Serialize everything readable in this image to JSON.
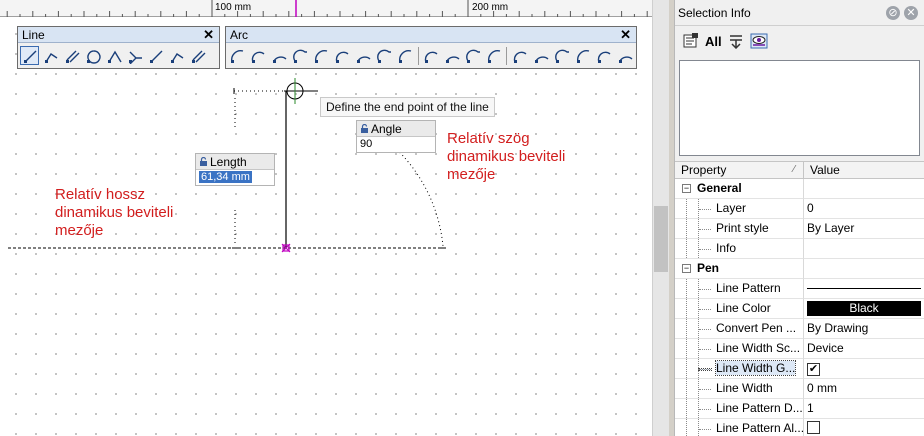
{
  "ruler": {
    "label_100": "100 mm",
    "label_200": "200 mm"
  },
  "line_toolbar": {
    "title": "Line",
    "close": "✕",
    "icons": [
      "line-icon",
      "polyline-icon",
      "parallel-line-icon",
      "tangent-line-icon",
      "perpendicular-line-icon",
      "angle-line-icon",
      "bisector-line-icon",
      "extend-line-icon",
      "split-line-icon"
    ]
  },
  "arc_toolbar": {
    "title": "Arc",
    "close": "✕",
    "icons": [
      "arc-3point-icon",
      "arc-center-icon",
      "arc-start-end-icon",
      "arc-tangent-icon",
      "arc-radius-icon",
      "arc-chord-icon",
      "arc-continue-icon",
      "arc-angle-icon",
      "arc-mirror-icon",
      "arc-concentric-icon",
      "arc-offset-icon",
      "arc-fillet-icon",
      "arc-reverse-icon",
      "arc-join-icon",
      "arc-loop-icon",
      "arc-split-icon",
      "arc-trim-icon",
      "arc-extend-icon",
      "arc-delete-icon"
    ]
  },
  "canvas": {
    "tooltip": "Define the end point of the line",
    "length_label": "Length",
    "length_value": "61,34 mm",
    "angle_label": "Angle",
    "angle_value": "90",
    "note_angle": "Relatív szög\ndinamikus beviteli\nmezője",
    "note_length": "Relatív hossz\ndinamikus beviteli\nmezője"
  },
  "panel": {
    "title": "Selection Info",
    "pin": "⊘",
    "close": "✕",
    "all_label": "All",
    "col_property": "Property",
    "col_value": "Value",
    "rows": [
      {
        "type": "group",
        "label": "General"
      },
      {
        "type": "item",
        "label": "Layer",
        "value": "0"
      },
      {
        "type": "item",
        "label": "Print style",
        "value": "By Layer"
      },
      {
        "type": "item",
        "label": "Info",
        "value": ""
      },
      {
        "type": "group",
        "label": "Pen"
      },
      {
        "type": "item",
        "label": "Line Pattern",
        "kind": "pattern"
      },
      {
        "type": "item",
        "label": "Line Color",
        "kind": "color",
        "value": "Black"
      },
      {
        "type": "item",
        "label": "Convert Pen ...",
        "value": "By Drawing"
      },
      {
        "type": "item",
        "label": "Line Width Sc...",
        "value": "Device"
      },
      {
        "type": "item",
        "label": "Line Width G...",
        "kind": "checkbox",
        "checked": true,
        "highlight": true
      },
      {
        "type": "item",
        "label": "Line Width",
        "value": "0 mm"
      },
      {
        "type": "item",
        "label": "Line Pattern D...",
        "value": "1"
      },
      {
        "type": "item",
        "label": "Line Pattern Al...",
        "kind": "checkbox",
        "checked": false
      }
    ]
  }
}
